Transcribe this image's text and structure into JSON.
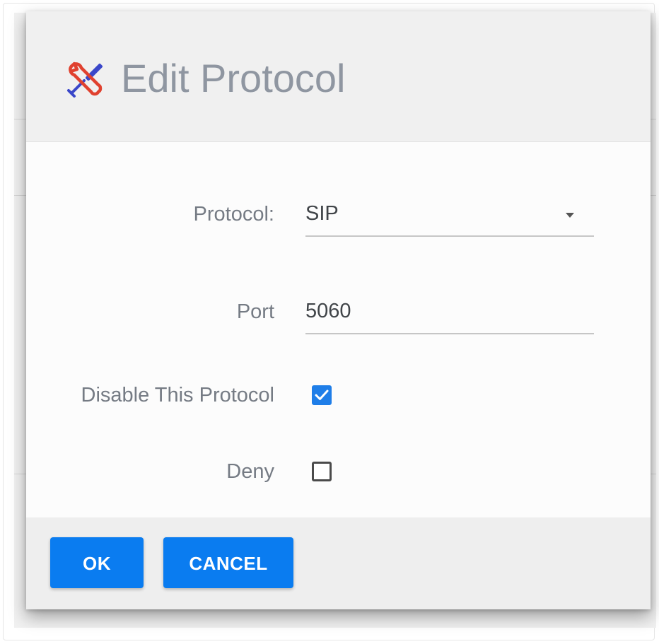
{
  "dialog": {
    "title": "Edit Protocol",
    "icon": "wrench-screwdriver-icon"
  },
  "form": {
    "protocol": {
      "label": "Protocol:",
      "value": "SIP"
    },
    "port": {
      "label": "Port",
      "value": "5060"
    },
    "disable_protocol": {
      "label": "Disable This Protocol",
      "checked": true
    },
    "deny": {
      "label": "Deny",
      "checked": false
    }
  },
  "buttons": {
    "ok_label": "OK",
    "cancel_label": "CANCEL"
  },
  "colors": {
    "accent": "#0a7cf0",
    "checkbox_checked": "#1f7ee8",
    "label_text": "#757b84",
    "title_text": "#8f96a1"
  }
}
